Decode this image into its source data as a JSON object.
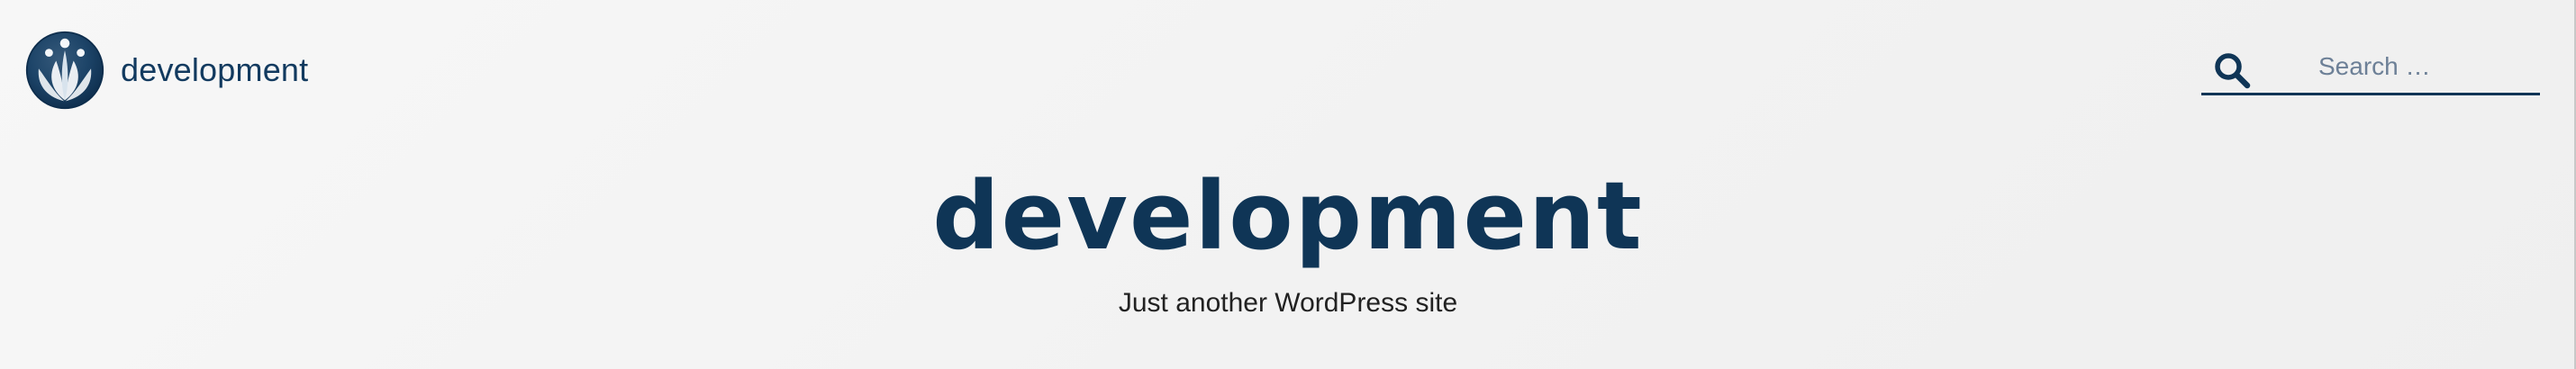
{
  "site": {
    "name": "development",
    "tagline": "Just another WordPress site"
  },
  "header": {
    "logo_icon": "lotus-logo-icon"
  },
  "search": {
    "placeholder": "Search …",
    "icon": "search-icon"
  },
  "colors": {
    "brand": "#0f3556",
    "background": "#f3f3f3",
    "tagline": "#222222"
  }
}
